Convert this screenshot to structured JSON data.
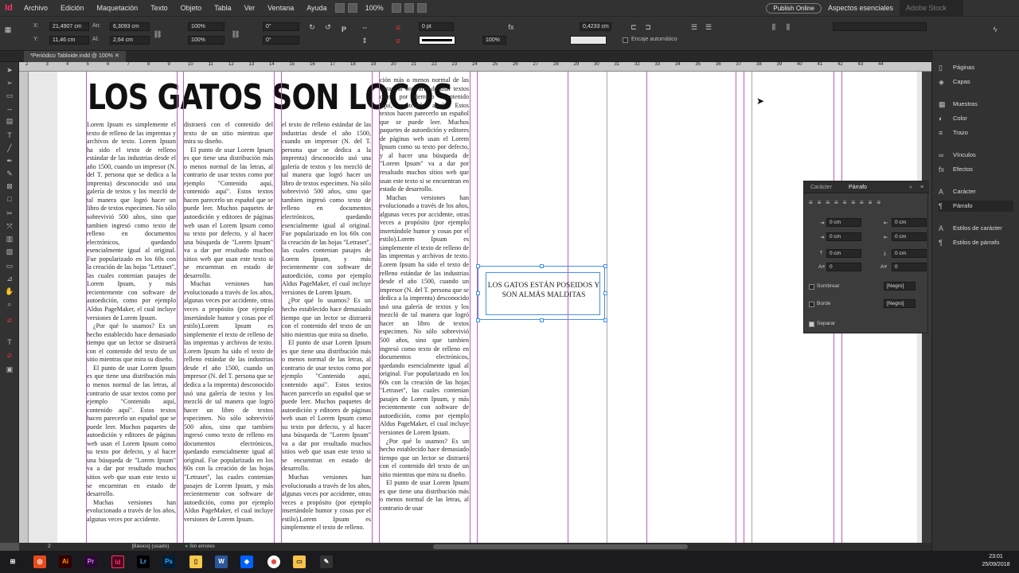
{
  "menu": {
    "logo": "Id",
    "items": [
      "Archivo",
      "Edición",
      "Maquetación",
      "Texto",
      "Objeto",
      "Tabla",
      "Ver",
      "Ventana",
      "Ayuda"
    ],
    "zoom": "100%",
    "publish_label": "Publish Online",
    "workspace": "Aspectos esenciales",
    "search_placeholder": "Adobe Stock"
  },
  "control": {
    "x_label": "X:",
    "x_value": "21,4907 cm",
    "y_label": "Y:",
    "y_value": "11,46 cm",
    "w_label": "An:",
    "w_value": "6,3093 cm",
    "h_label": "Al:",
    "h_value": "2,64 cm",
    "scale_x": "100%",
    "scale_y": "100%",
    "rotate": "0°",
    "shear": "0°",
    "stroke_weight": "0 pt",
    "opacity": "100%",
    "offset": "0,4233 cm",
    "autofit_label": "Encaje automático"
  },
  "document": {
    "tab_title": "*Periódico Tabloide.indd @ 100%",
    "headline": "LOS GATOS SON LOCOS",
    "pullquote": "LOS GATOS ESTÁN POSEIDOS Y SON ALMÁS MALDITAS"
  },
  "ruler": {
    "ticks": [
      "2",
      "3",
      "4",
      "5",
      "6",
      "7",
      "8",
      "9",
      "10",
      "11",
      "12",
      "13",
      "14",
      "15",
      "16",
      "17",
      "18",
      "19",
      "20",
      "21",
      "22",
      "23",
      "24",
      "25",
      "26",
      "27",
      "28",
      "29",
      "30",
      "31",
      "32",
      "33",
      "34",
      "35",
      "36",
      "37",
      "38",
      "39",
      "40",
      "41",
      "42",
      "43",
      "44"
    ]
  },
  "columns": {
    "col1": [
      "Lorem Ipsum es simplemente el texto de relleno de las imprentas y archivos de texto. Lorem Ipsum ha sido el texto de relleno estándar de las industrias desde el año 1500, cuando un impresor (N. del T. persona que se dedica a la imprenta) desconocido usó una galería de textos y los mezcló de tal manera que logró hacer un libro de textos especimen. No sólo sobrevivió 500 años, sino que tambien ingresó como texto de relleno en documentos electrónicos, quedando esencialmente igual al original. Fue popularizado en los 60s con la creación de las hojas \"Letraset\", las cuales contenian pasajes de Lorem Ipsum, y más recientemente con software de autoedición, como por ejemplo Aldus PageMaker, el cual incluye versiones de Lorem Ipsum.",
      "¿Por qué lo usamos? Es un hecho establecido hace demasiado tiempo que un lector se distraerá con el contenido del texto de un sitio mientras que mira su diseño.",
      "El punto de usar Lorem Ipsum es que tiene una distribución más o menos normal de las letras, al contrario de usar textos como por ejemplo \"Contenido aquí, contenido aquí\". Estos textos hacen parecerlo un español que se puede leer. Muchos paquetes de autoedición y editores de páginas web usan el Lorem Ipsum como su texto por defecto, y al hacer una búsqueda de \"Lorem Ipsum\" va a dar por resultado muchos sitios web que usan este texto si se encuentran en estado de desarrollo.",
      "Muchas versiones han evolucionado a través de los años, algunas veces por accidente."
    ],
    "col2": [
      "distraerá con el contenido del texto de un sitio mientras que mira su diseño.",
      "El punto de usar Lorem Ipsum es que tiene una distribución más o menos normal de las letras, al contrario de usar textos como por ejemplo \"Contenido aquí, contenido aquí\". Estos textos hacen parecerlo un español que se puede leer. Muchos paquetes de autoedición y editores de páginas web usan el Lorem Ipsum como su texto por defecto, y al hacer una búsqueda de \"Lorem Ipsum\" va a dar por resultado muchos sitios web que usan este texto si se encuentran en estado de desarrollo.",
      "Muchas versiones han evolucionado a través de los años, algunas veces por accidente, otras veces a propósito (por ejemplo insertándole humor y cosas por el estilo).Lorem Ipsum es simplemente el texto de relleno de las imprentas y archivos de texto. Lorem Ipsum ha sido el texto de relleno estándar de las industrias desde el año 1500, cuando un impresor (N. del T. persona que se dedica a la imprenta) desconocido usó una galería de textos y los mezcló de tal manera que logró hacer un libro de textos especimen. No sólo sobrevivió 500 años, sino que tambien ingresó como texto de relleno en documentos electrónicos, quedando esencialmente igual al original. Fue popularizado en los 60s con la creación de las hojas \"Letraset\", las cuales contenian pasajes de Lorem Ipsum, y más recientemente con software de autoedición, como por ejemplo Aldus PageMaker, el cual incluye versiones de Lorem Ipsum."
    ],
    "col3": [
      "el texto de relleno estándar de las industrias desde el año 1500, cuando un impresor (N. del T. persona que se dedica a la imprenta) desconocido usó una galería de textos y los mezcló de tal manera que logró hacer un libro de textos especimen. No sólo sobrevivió 500 años, sino que tambien ingresó como texto de relleno en documentos electrónicos, quedando esencialmente igual al original. Fue popularizado en los 60s con la creación de las hojas \"Letraset\", las cuales contenian pasajes de Lorem Ipsum, y más recientemente con software de autoedición, como por ejemplo Aldus PageMaker, el cual incluye versiones de Lorem Ipsum.",
      "¿Por qué lo usamos? Es un hecho establecido hace demasiado tiempo que un lector se distraerá con el contenido del texto de un sitio mientras que mira su diseño.",
      "El punto de usar Lorem Ipsum es que tiene una distribución más o menos normal de las letras, al contrario de usar textos como por ejemplo \"Contenido aquí, contenido aquí\". Estos textos hacen parecerlo un español que se puede leer. Muchos paquetes de autoedición y editores de páginas web usan el Lorem Ipsum como su texto por defecto, y al hacer una búsqueda de \"Lorem Ipsum\" va a dar por resultado muchos sitios web que usan este texto si se encuentran en estado de desarrollo.",
      "Muchas versiones han evolucionado a través de los años, algunas veces por accidente, otras veces a propósito (por ejemplo insertándole humor y cosas por el estilo).Lorem Ipsum es simplemente el texto de relleno."
    ],
    "col4": [
      "ción más o menos normal de las letras, al contrario de usar textos como por ejemplo \"Contenido aquí, contenido aquí\". Estos textos hacen parecerlo un español que se puede leer. Muchos paquetes de autoedición y editores de páginas web usan el Lorem Ipsum como su texto por defecto, y al hacer una búsqueda de \"Lorem Ipsum\" va a dar por resultado muchos sitios web que usan este texto si se encuentran en estado de desarrollo.",
      "Muchas versiones han evolucionado a través de los años, algunas veces por accidente, otras veces a propósito (por ejemplo insertándole humor y cosas por el estilo).Lorem Ipsum es simplemente el texto de relleno de las imprentas y archivos de texto. Lorem Ipsum ha sido el texto de relleno estándar de las industrias desde el año 1500, cuando un impresor (N. del T. persona que se dedica a la imprenta) desconocido usó una galería de textos y los mezcló de tal manera que logró hacer un libro de textos especimen. No sólo sobrevivió 500 años, sino que tambien ingresó como texto de relleno en documentos electrónicos, quedando esencialmente igual al original. Fue popularizado en los 60s con la creación de las hojas \"Letraset\", las cuales contenian pasajes de Lorem Ipsum, y más recientemente con software de autoedición, como por ejemplo Aldus PageMaker, el cual incluye versiones de Lorem Ipsum.",
      "¿Por qué lo usamos? Es un hecho establecido hace demasiado tiempo que un lector se distraerá con el contenido del texto de un sitio mientras que mira su diseño.",
      "El punto de usar Lorem Ipsum es que tiene una distribución más o menos normal de las letras, al contrario de usar"
    ]
  },
  "right_panel": {
    "items": [
      {
        "icon": "pages-icon",
        "label": "Páginas"
      },
      {
        "icon": "layers-icon",
        "label": "Capas"
      },
      {
        "icon": "swatches-icon",
        "label": "Muestras"
      },
      {
        "icon": "color-icon",
        "label": "Color"
      },
      {
        "icon": "stroke-icon",
        "label": "Trazo"
      },
      {
        "icon": "links-icon",
        "label": "Vínculos"
      },
      {
        "icon": "effects-icon",
        "label": "Efectos"
      },
      {
        "icon": "character-icon",
        "label": "Carácter"
      },
      {
        "icon": "paragraph-icon",
        "label": "Párrafo"
      },
      {
        "icon": "character-styles-icon",
        "label": "Estilos de carácter"
      },
      {
        "icon": "paragraph-styles-icon",
        "label": "Estilos de párrafo"
      }
    ]
  },
  "paragraph_panel": {
    "tab_character": "Carácter",
    "tab_paragraph": "Párrafo",
    "left_indent": "0 cm",
    "right_indent": "0 cm",
    "first_indent": "0 cm",
    "last_indent": "0 cm",
    "space_before": "0 cm",
    "space_after": "0 cm",
    "drop_lines": "0",
    "drop_chars": "0",
    "shading_label": "Sombrear",
    "border_label": "Borde",
    "swatch_shading": "[Negro]",
    "swatch_border": "[Negro]",
    "split_label": "Separar"
  },
  "status": {
    "page": "2",
    "style": "[Básico] (usado)",
    "preflight": "Sin errores"
  },
  "taskbar": {
    "time": "23:01",
    "date": "25/09/2018"
  },
  "colors": {
    "accent": "#4a90e2",
    "guide": "#c45bc4",
    "id_brand": "#ff3366"
  }
}
